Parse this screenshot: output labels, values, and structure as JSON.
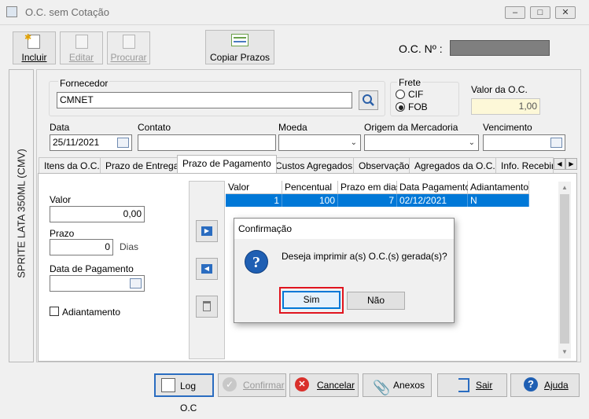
{
  "window": {
    "title": "O.C. sem Cotação"
  },
  "toolbar": {
    "incluir": "Incluir",
    "editar": "Editar",
    "procurar": "Procurar",
    "copiar_prazos": "Copiar Prazos"
  },
  "oc_numero": {
    "label": "O.C. Nº :",
    "value": ""
  },
  "side_label": "SPRITE LATA 350ML (CMV)",
  "fornecedor": {
    "label": "Fornecedor",
    "value": "CMNET"
  },
  "frete": {
    "label": "Frete",
    "options": [
      "CIF",
      "FOB"
    ],
    "selected": "FOB"
  },
  "valor_oc": {
    "label": "Valor da O.C.",
    "value": "1,00"
  },
  "data": {
    "label": "Data",
    "value": "25/11/2021"
  },
  "contato": {
    "label": "Contato",
    "value": ""
  },
  "moeda": {
    "label": "Moeda",
    "value": ""
  },
  "origem": {
    "label": "Origem da Mercadoria",
    "value": ""
  },
  "vencimento": {
    "label": "Vencimento",
    "value": ""
  },
  "tabs": [
    "Itens da O.C.",
    "Prazo de Entrega",
    "Prazo de Pagamento",
    "Custos Agregados",
    "Observação",
    "Agregados da O.C.",
    "Info. Recebim"
  ],
  "active_tab": "Prazo de Pagamento",
  "pagamento_form": {
    "valor_label": "Valor",
    "valor": "0,00",
    "prazo_label": "Prazo",
    "prazo": "0",
    "dias": "Dias",
    "data_pag_label": "Data de Pagamento",
    "data_pag": "",
    "adiantamento_label": "Adiantamento"
  },
  "grid": {
    "columns": [
      "Valor",
      "Pencentual",
      "Prazo em dias",
      "Data Pagamento",
      "Adiantamento"
    ],
    "rows": [
      [
        "1",
        "100",
        "7",
        "02/12/2021",
        "N"
      ]
    ]
  },
  "dialog": {
    "title": "Confirmação",
    "message": "Deseja imprimir a(s) O.C.(s) gerada(s)?",
    "yes": "Sim",
    "no": "Não"
  },
  "bottom_buttons": {
    "log": "Log O.C",
    "confirmar": "Confirmar",
    "cancelar": "Cancelar",
    "anexos": "Anexos",
    "sair": "Sair",
    "ajuda": "Ajuda"
  },
  "colors": {
    "selection": "#0078d7",
    "highlight_border": "#e0141e",
    "readonly_yellow": "#fdf8d8"
  }
}
